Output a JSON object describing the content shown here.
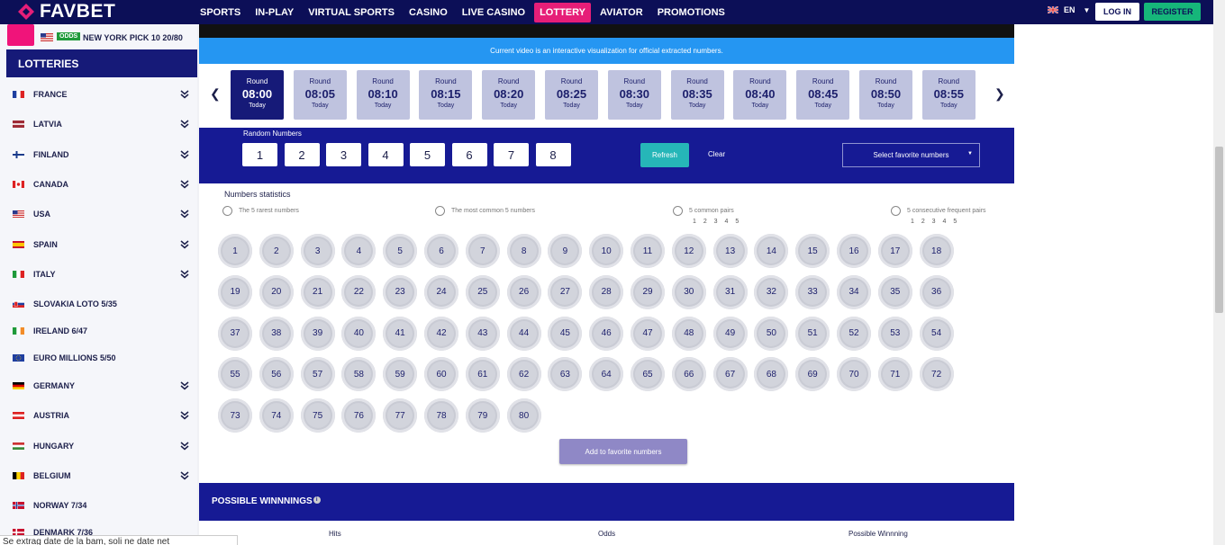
{
  "brand": "FAVBET",
  "nav": [
    "SPORTS",
    "IN-PLAY",
    "VIRTUAL SPORTS",
    "CASINO",
    "LIVE CASINO",
    "LOTTERY",
    "AVIATOR",
    "PROMOTIONS"
  ],
  "nav_active": "LOTTERY",
  "lang": "EN",
  "login": "LOG IN",
  "register": "REGISTER",
  "colors": {
    "accent": "#e61e78",
    "nav_bg": "#0c0f57",
    "register": "#16b67a",
    "panel": "#161a94"
  },
  "sidebar": {
    "top_item": {
      "odds": "ODDS",
      "name": "NEW YORK PICK 10 20/80"
    },
    "header": "LOTTERIES",
    "items": [
      {
        "label": "FRANCE",
        "flag": "fr",
        "expandable": true
      },
      {
        "label": "LATVIA",
        "flag": "lv",
        "expandable": true
      },
      {
        "label": "FINLAND",
        "flag": "fi",
        "expandable": true
      },
      {
        "label": "CANADA",
        "flag": "ca",
        "expandable": true
      },
      {
        "label": "USA",
        "flag": "us",
        "expandable": true
      },
      {
        "label": "SPAIN",
        "flag": "es",
        "expandable": true
      },
      {
        "label": "ITALY",
        "flag": "it",
        "expandable": true
      },
      {
        "label": "SLOVAKIA LOTO 5/35",
        "flag": "sk",
        "expandable": false
      },
      {
        "label": "IRELAND 6/47",
        "flag": "ie",
        "expandable": false
      },
      {
        "label": "EURO MILLIONS 5/50",
        "flag": "eu",
        "expandable": false
      },
      {
        "label": "GERMANY",
        "flag": "de",
        "expandable": true
      },
      {
        "label": "AUSTRIA",
        "flag": "at",
        "expandable": true
      },
      {
        "label": "HUNGARY",
        "flag": "hu",
        "expandable": true
      },
      {
        "label": "BELGIUM",
        "flag": "be",
        "expandable": true
      },
      {
        "label": "NORWAY 7/34",
        "flag": "no",
        "expandable": false
      },
      {
        "label": "DENMARK 7/36",
        "flag": "dk",
        "expandable": false
      }
    ]
  },
  "notice": "Current video is an interactive visualization for official extracted numbers.",
  "rounds": [
    {
      "label": "Round",
      "time": "08:00",
      "day": "Today",
      "active": true
    },
    {
      "label": "Round",
      "time": "08:05",
      "day": "Today"
    },
    {
      "label": "Round",
      "time": "08:10",
      "day": "Today"
    },
    {
      "label": "Round",
      "time": "08:15",
      "day": "Today"
    },
    {
      "label": "Round",
      "time": "08:20",
      "day": "Today"
    },
    {
      "label": "Round",
      "time": "08:25",
      "day": "Today"
    },
    {
      "label": "Round",
      "time": "08:30",
      "day": "Today"
    },
    {
      "label": "Round",
      "time": "08:35",
      "day": "Today"
    },
    {
      "label": "Round",
      "time": "08:40",
      "day": "Today"
    },
    {
      "label": "Round",
      "time": "08:45",
      "day": "Today"
    },
    {
      "label": "Round",
      "time": "08:50",
      "day": "Today"
    },
    {
      "label": "Round",
      "time": "08:55",
      "day": "Today"
    }
  ],
  "random": {
    "title": "Random Numbers",
    "numbers": [
      "1",
      "2",
      "3",
      "4",
      "5",
      "6",
      "7",
      "8"
    ],
    "refresh": "Refresh",
    "clear": "Clear",
    "favorite_select": "Select favorite numbers"
  },
  "stats": {
    "title": "Numbers statistics",
    "options": [
      "The 5 rarest numbers",
      "The most common 5 numbers",
      "5 common pairs",
      "5 consecutive frequent pairs"
    ],
    "pair_numbers": "1 2 3 4 5"
  },
  "balls": [
    "1",
    "2",
    "3",
    "4",
    "5",
    "6",
    "7",
    "8",
    "9",
    "10",
    "11",
    "12",
    "13",
    "14",
    "15",
    "16",
    "17",
    "18",
    "19",
    "20",
    "21",
    "22",
    "23",
    "24",
    "25",
    "26",
    "27",
    "28",
    "29",
    "30",
    "31",
    "32",
    "33",
    "34",
    "35",
    "36",
    "37",
    "38",
    "39",
    "40",
    "41",
    "42",
    "43",
    "44",
    "45",
    "46",
    "47",
    "48",
    "49",
    "50",
    "51",
    "52",
    "53",
    "54",
    "55",
    "56",
    "57",
    "58",
    "59",
    "60",
    "61",
    "62",
    "63",
    "64",
    "65",
    "66",
    "67",
    "68",
    "69",
    "70",
    "71",
    "72",
    "73",
    "74",
    "75",
    "76",
    "77",
    "78",
    "79",
    "80"
  ],
  "add_favorite": "Add to favorite numbers",
  "winnings": {
    "title": "POSSIBLE WINNNINGS",
    "info": "i",
    "columns": [
      "Hits",
      "Odds",
      "Possible Winnning"
    ]
  },
  "bottom_text": "Se extrag date de la bam, soli ne date net"
}
